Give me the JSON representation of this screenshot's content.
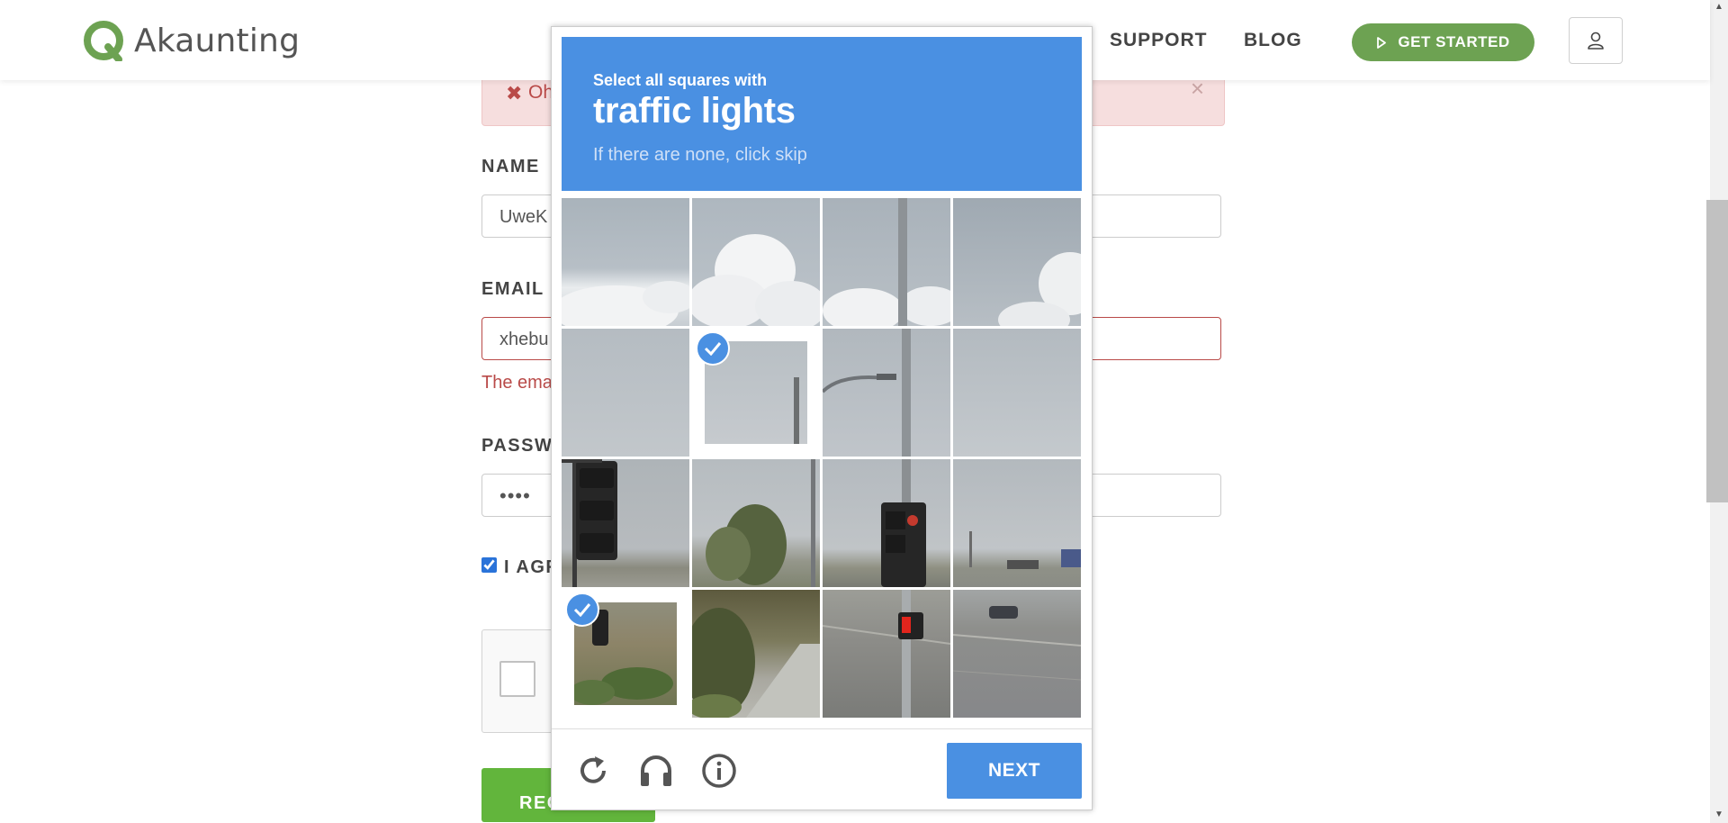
{
  "header": {
    "brand": "Akaunting",
    "nav": [
      {
        "label": "SUPPORT"
      },
      {
        "label": "BLOG"
      }
    ],
    "cta_label": "GET STARTED"
  },
  "alert": {
    "text": "Oh",
    "close": "×"
  },
  "form": {
    "name_label": "NAME",
    "name_value": "UweK",
    "email_label": "EMAIL",
    "email_value": "xhebu",
    "email_error": "The ema",
    "password_label": "PASSWO",
    "password_value": "••••",
    "agree_label": "I AGR",
    "agree_checked": true,
    "register_label": "REG"
  },
  "captcha": {
    "instruction": "Select all squares with",
    "target": "traffic lights",
    "hint": "If there are none, click skip",
    "next_label": "NEXT",
    "selected_tiles": [
      5,
      12
    ],
    "accent": "#4a90e2"
  },
  "colors": {
    "brand_green": "#6da252",
    "register_green": "#62b53c",
    "error_red": "#b94a48"
  }
}
